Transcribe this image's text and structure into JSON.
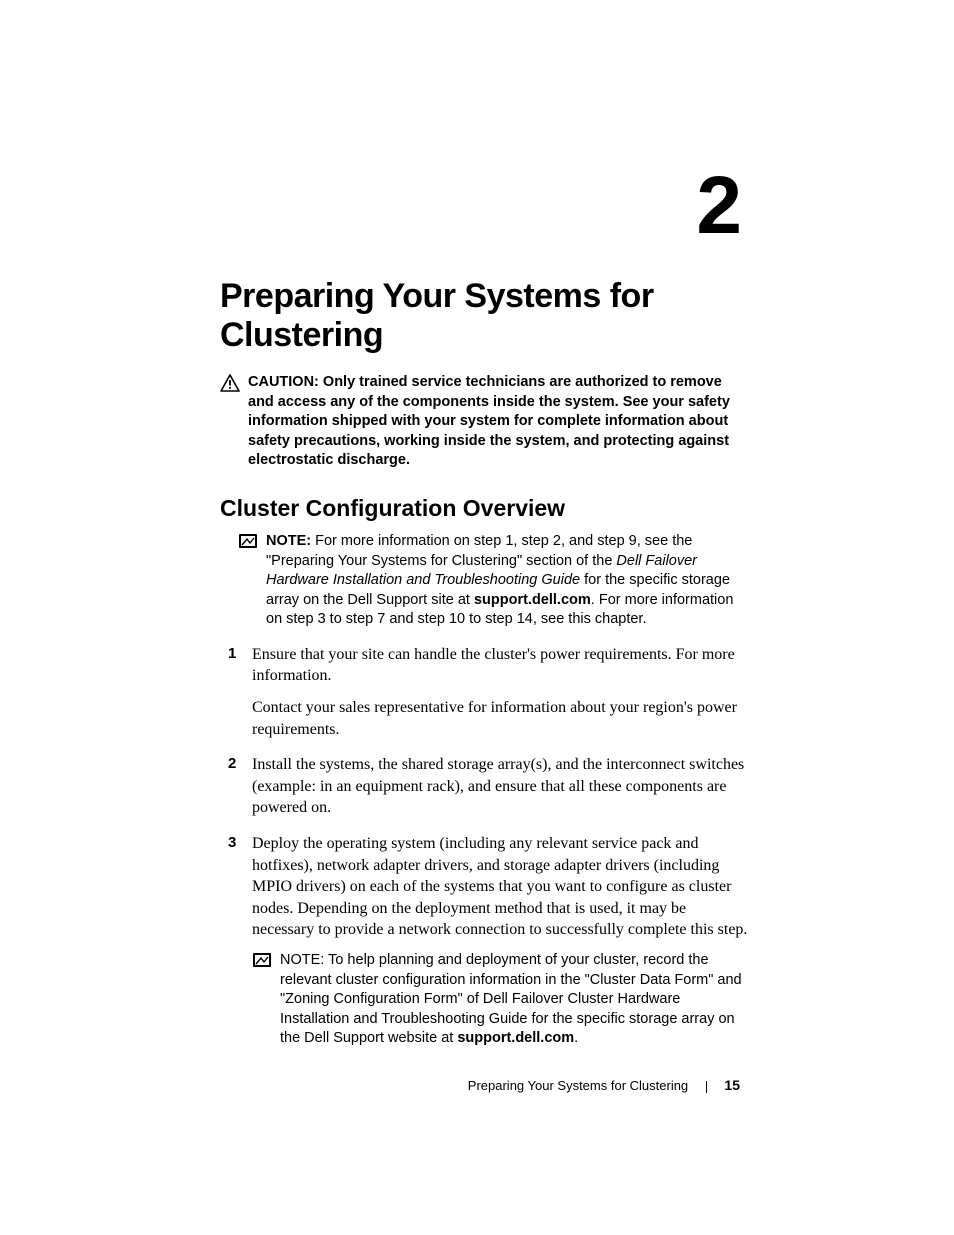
{
  "chapter": {
    "number": "2",
    "title": "Preparing Your Systems for Clustering"
  },
  "caution": {
    "label": "CAUTION:",
    "text": "Only trained service technicians are authorized to remove and access any of the components inside the system. See your safety information shipped with your system for complete information about safety precautions, working inside the system, and protecting against electrostatic discharge."
  },
  "section": {
    "title": "Cluster Configuration Overview"
  },
  "note1": {
    "label": "NOTE:",
    "p1": "For more information on step 1, step 2, and step 9, see the \"Preparing Your Systems for Clustering\" section of the ",
    "p2": "Dell Failover Hardware Installation and Troubleshooting Guide",
    "p3": " for the specific storage array on the Dell Support site at ",
    "p4": "support.dell.com",
    "p5": ". For more information on step 3 to step 7 and step 10 to step 14, see this chapter."
  },
  "steps": {
    "s1a": "Ensure that your site can handle the cluster's power requirements. For more information.",
    "s1b": "Contact your sales representative for information about your region's power requirements.",
    "s2": "Install the systems, the shared storage array(s), and the interconnect switches (example: in an equipment rack), and ensure that all these components are powered on.",
    "s3": "Deploy the operating system (including any relevant service pack and hotfixes), network adapter drivers, and storage adapter drivers (including MPIO drivers) on each of the systems that you want to configure as cluster nodes. Depending on the deployment method that is used, it may be necessary to provide a network connection to successfully complete this step."
  },
  "note2": {
    "label": "NOTE:",
    "p1": "To help planning and deployment of your cluster, record the relevant cluster configuration information in the \"Cluster Data Form\" and \"Zoning Configuration Form\" of Dell Failover Cluster Hardware Installation and Troubleshooting Guide for the specific storage array on the Dell Support website at ",
    "p2": "support.dell.com",
    "p3": "."
  },
  "footer": {
    "title": "Preparing Your Systems for Clustering",
    "page": "15"
  }
}
